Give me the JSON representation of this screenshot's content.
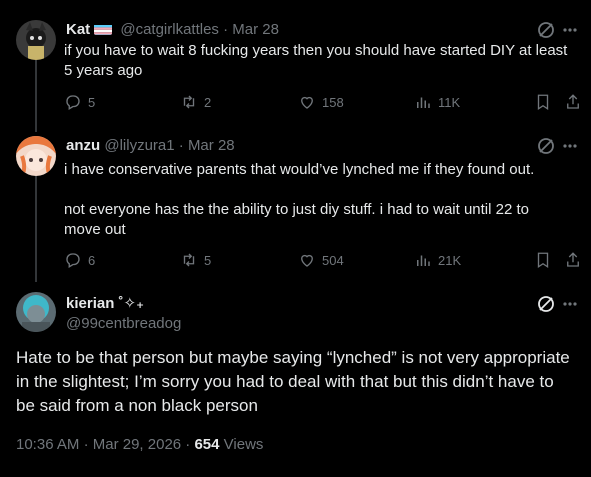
{
  "tweets": [
    {
      "name": "Kat",
      "handle": "@catgirlkattles",
      "date": "Mar 28",
      "text_lines": [
        "if you have to wait 8 fucking years then you should have started DIY at least",
        "5 years ago"
      ],
      "replies": "5",
      "reposts": "2",
      "likes": "158",
      "views": "11K"
    },
    {
      "name": "anzu",
      "handle": "@lilyzura1",
      "date": "Mar 28",
      "text_p1": "i have conservative parents that would’ve lynched me if they found out.",
      "text_p2_lines": [
        "not everyone has the the ability to just diy stuff. i had to wait until 22 to",
        "move out"
      ],
      "replies": "6",
      "reposts": "5",
      "likes": "504",
      "views": "21K"
    }
  ],
  "main": {
    "name": "kierian ˚✧₊",
    "handle": "@99centbreadog",
    "text": "Hate to be that person but maybe saying “lynched” is not very appropriate in the slightest; I’m sorry you had to deal with that but this didn’t have to be said from a non black person",
    "time": "10:36 AM",
    "date": "Mar 29, 2026",
    "views_count": "654",
    "views_label": "Views",
    "sep": "·"
  },
  "colors": {
    "bg": "#000000",
    "text": "#e7e9ea",
    "muted": "#71767b",
    "line": "#333639"
  }
}
